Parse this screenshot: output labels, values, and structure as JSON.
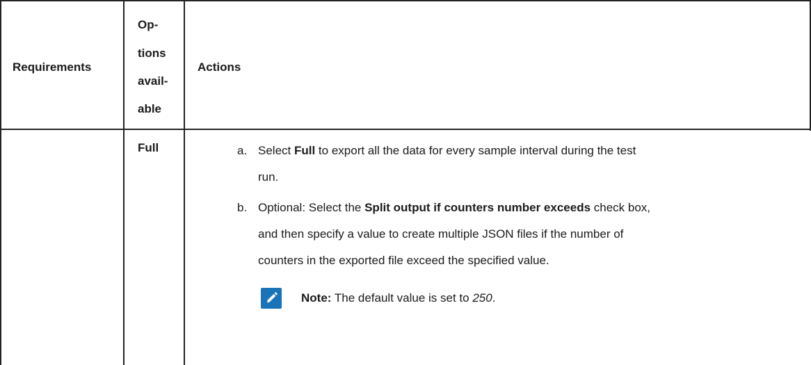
{
  "table": {
    "headers": {
      "requirements": "Requirements",
      "options_available": [
        "Op-",
        "tions",
        "avail-",
        "able"
      ],
      "actions": "Actions"
    },
    "row": {
      "requirements": "",
      "option": "Full",
      "steps": [
        {
          "marker": "a.",
          "pre": "Select ",
          "bold": "Full",
          "post_line1": " to export all the data for every sample interval during the test",
          "post_line2": "run."
        },
        {
          "marker": "b.",
          "pre": "Optional: Select the ",
          "bold": "Split output if counters number exceeds",
          "post_line1": " check box,",
          "line2": "and then specify a value to create multiple JSON files if the number of",
          "line3": "counters in the exported file exceed the specified value."
        }
      ],
      "note": {
        "icon": "pencil-icon",
        "label": "Note:",
        "text": " The default value is set to ",
        "value": "250",
        "end": "."
      }
    }
  },
  "colors": {
    "grid": "#222222",
    "note_icon": "#1a73b8",
    "text": "#1a1a1a"
  }
}
